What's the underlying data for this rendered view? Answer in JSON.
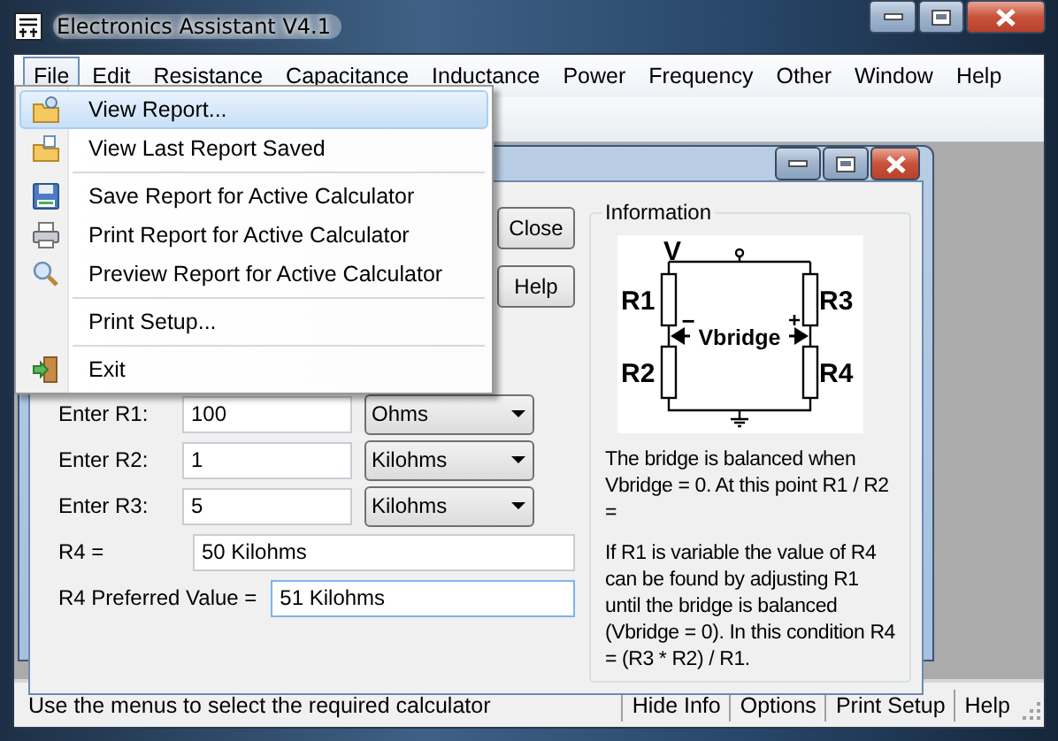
{
  "window": {
    "title": "Electronics Assistant V4.1"
  },
  "menu_bar": [
    {
      "label": "File",
      "open": true
    },
    {
      "label": "Edit",
      "open": false
    },
    {
      "label": "Resistance",
      "open": false
    },
    {
      "label": "Capacitance",
      "open": false
    },
    {
      "label": "Inductance",
      "open": false
    },
    {
      "label": "Power",
      "open": false
    },
    {
      "label": "Frequency",
      "open": false
    },
    {
      "label": "Other",
      "open": false
    },
    {
      "label": "Window",
      "open": false
    },
    {
      "label": "Help",
      "open": false
    }
  ],
  "file_menu": [
    {
      "kind": "item",
      "label": "View Report...",
      "selected": true
    },
    {
      "kind": "item",
      "label": "View Last Report Saved",
      "selected": false
    },
    {
      "kind": "separator"
    },
    {
      "kind": "item",
      "label": "Save Report for Active Calculator",
      "selected": false
    },
    {
      "kind": "item",
      "label": "Print Report for Active Calculator",
      "selected": false
    },
    {
      "kind": "item",
      "label": "Preview Report for Active Calculator",
      "selected": false
    },
    {
      "kind": "separator"
    },
    {
      "kind": "item",
      "label": "Print Setup...",
      "selected": false
    },
    {
      "kind": "separator"
    },
    {
      "kind": "item",
      "label": "Exit",
      "selected": false
    }
  ],
  "calculator": {
    "buttons": [
      "Close",
      "Help"
    ],
    "inputs": [
      {
        "label": "Enter R1:",
        "value": "100",
        "unit": "Ohms"
      },
      {
        "label": "Enter R2:",
        "value": "1",
        "unit": "Kilohms"
      },
      {
        "label": "Enter R3:",
        "value": "5",
        "unit": "Kilohms"
      }
    ],
    "results": [
      {
        "label": "R4 =",
        "value": "50 Kilohms",
        "focused": false
      },
      {
        "label": "R4 Preferred Value =",
        "value": "51 Kilohms",
        "focused": true
      }
    ],
    "information": {
      "title": "Information",
      "diagram": {
        "supply": "V",
        "resistors": [
          "R1",
          "R2",
          "R3",
          "R4"
        ],
        "bridge": "Vbridge",
        "minus": "−",
        "plus": "+"
      },
      "paragraphs": [
        "The bridge is balanced when Vbridge = 0. At this point R1 / R2 =",
        "If R1 is variable the value of R4 can be found by adjusting R1 until the bridge is balanced (Vbridge = 0). In this condition R4 = (R3 * R2) / R1."
      ]
    }
  },
  "status_bar": {
    "message": "Use the menus to select the required calculator",
    "panels": [
      "Hide Info",
      "Options",
      "Print Setup",
      "Help"
    ]
  }
}
